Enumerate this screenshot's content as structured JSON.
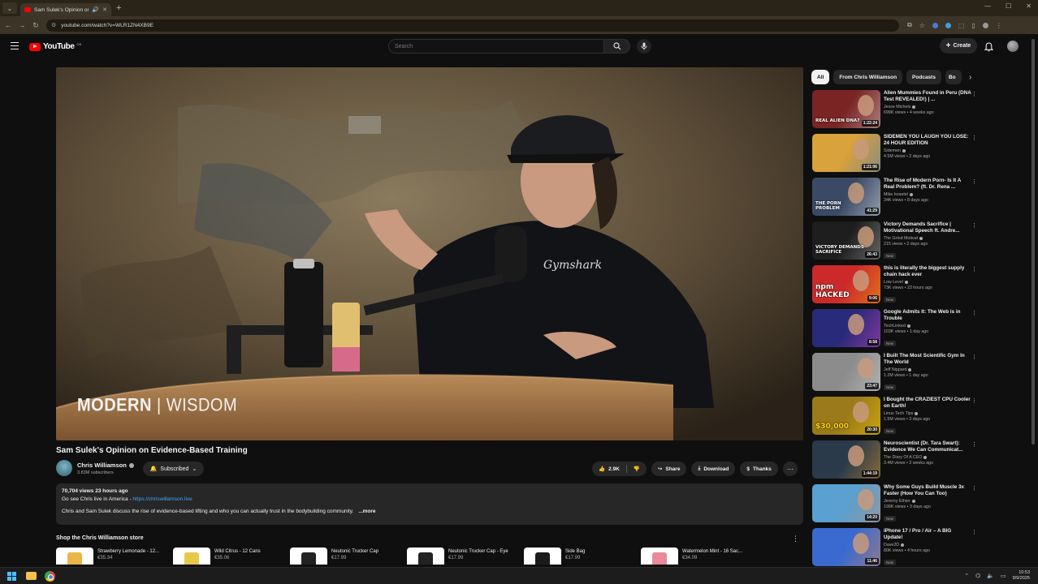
{
  "browser": {
    "tab_title": "Sam Sulek's Opinion on E...",
    "url": "youtube.com/watch?v=WLR1ZN4XB9E"
  },
  "masthead": {
    "logo_text": "YouTube",
    "logo_country": "GB",
    "search_placeholder": "Search",
    "create_label": "Create"
  },
  "video": {
    "watermark_bold": "MODERN",
    "watermark_light": "WISDOM",
    "title": "Sam Sulek's Opinion on Evidence-Based Training",
    "channel": "Chris Williamson",
    "subscribers": "3.83M subscribers",
    "subscribe_label": "Subscribed",
    "likes": "2.9K",
    "share_label": "Share",
    "download_label": "Download",
    "thanks_label": "Thanks"
  },
  "description": {
    "meta": "70,704 views  23 hours ago",
    "promo_prefix": "Go see Chris live in America - ",
    "promo_link": "https://chriswillamson.live",
    "body": "Chris and Sam Sulek discuss the rise of evidence-based lifting and who you can actually trust in the bodybuilding community.",
    "more": "...more"
  },
  "store": {
    "title": "Shop the Chris Williamson store",
    "items": [
      {
        "name": "Strawberry Lemonade - 12...",
        "price": "€35.34",
        "color": "#e9b64a"
      },
      {
        "name": "Wild Citrus - 12 Cans",
        "price": "€35.06",
        "color": "#e9c94a"
      },
      {
        "name": "Neutonic Trucker Cap",
        "price": "€17.99",
        "color": "#222222"
      },
      {
        "name": "Neutonic Trucker Cap - Eye",
        "price": "€17.99",
        "color": "#222222"
      },
      {
        "name": "Side Bag",
        "price": "€17.99",
        "color": "#1a1a1a"
      },
      {
        "name": "Watermelon Mint - 16 Sac...",
        "price": "€34.09",
        "color": "#e88a9a"
      }
    ]
  },
  "sidebar": {
    "chips": [
      "All",
      "From Chris Williamson",
      "Podcasts",
      "Bo"
    ],
    "recs": [
      {
        "title": "Alien Mummies Found in Peru (DNA Test REVEALED!) | ...",
        "channel": "Jesse Michels",
        "meta": "699K views • 4 weeks ago",
        "duration": "1:22:24",
        "badge": "",
        "bg": "#7a2424",
        "accent": "#e6e6e6",
        "label": "REAL ALIEN DNA?"
      },
      {
        "title": "SIDEMEN YOU LAUGH YOU LOSE: 24 HOUR EDITION",
        "channel": "Sidemen",
        "meta": "4.5M views • 2 days ago",
        "duration": "1:21:06",
        "badge": "",
        "bg": "#d9a23a",
        "accent": "#2a6fd6",
        "label": ""
      },
      {
        "title": "The Rise of Modern Porn- Is It A Real Problem? (ft. Dr. Rena ...",
        "channel": "Mike Israetel",
        "meta": "34K views • 8 days ago",
        "duration": "41:29",
        "badge": "",
        "bg": "#3a4a66",
        "accent": "#ffffff",
        "label": "THE PORN PROBLEM"
      },
      {
        "title": "Victory Demands Sacrifice | Motivational Speech ft. Andre...",
        "channel": "The Grind Motivat",
        "meta": "215 views • 2 days ago",
        "duration": "26:43",
        "badge": "New",
        "bg": "#1e1e1e",
        "accent": "#bbbbbb",
        "label": "VICTORY DEMANDS SACRIFICE"
      },
      {
        "title": "this is literally the biggest supply chain hack ever",
        "channel": "Low Level",
        "meta": "73K views • 23 hours ago",
        "duration": "9:06",
        "badge": "New",
        "bg": "#cc2a2a",
        "accent": "#f4c20d",
        "label": "npm HACKED"
      },
      {
        "title": "Google Admits It: The Web is in Trouble",
        "channel": "TechLinked",
        "meta": "103K views • 1 day ago",
        "duration": "8:58",
        "badge": "New",
        "bg": "#2a2a7a",
        "accent": "#e04ac0",
        "label": ""
      },
      {
        "title": "I Built The Most Scientific Gym In The World",
        "channel": "Jeff Nippard",
        "meta": "1.2M views • 1 day ago",
        "duration": "23:47",
        "badge": "New",
        "bg": "#8c8c8c",
        "accent": "#dddddd",
        "label": ""
      },
      {
        "title": "I Bought the CRAZIEST CPU Cooler on Earth!",
        "channel": "Linus Tech Tips",
        "meta": "1.5M views • 3 days ago",
        "duration": "20:30",
        "badge": "New",
        "bg": "#9a7a1a",
        "accent": "#ffd400",
        "label": "$30,000"
      },
      {
        "title": "Neuroscientist (Dr. Tara Swart): Evidence We Can Communicat...",
        "channel": "The Diary Of A CEO",
        "meta": "3.4M views • 3 weeks ago",
        "duration": "1:44:19",
        "badge": "",
        "bg": "#2a3a4a",
        "accent": "#f4a020",
        "label": ""
      },
      {
        "title": "Why Some Guys Build Muscle 3x Faster (How You Can Too)",
        "channel": "Jeremy Ethier",
        "meta": "199K views • 3 days ago",
        "duration": "14:20",
        "badge": "New",
        "bg": "#5aa0d0",
        "accent": "#d08c6a",
        "label": ""
      },
      {
        "title": "iPhone 17 / Pro / Air – A BIG Update!",
        "channel": "Dave2D",
        "meta": "80K views • 4 hours ago",
        "duration": "11:46",
        "badge": "New",
        "bg": "#3a6ad0",
        "accent": "#f08a40",
        "label": ""
      }
    ]
  },
  "taskbar": {
    "time": "10:53",
    "date": "9/9/2025"
  }
}
